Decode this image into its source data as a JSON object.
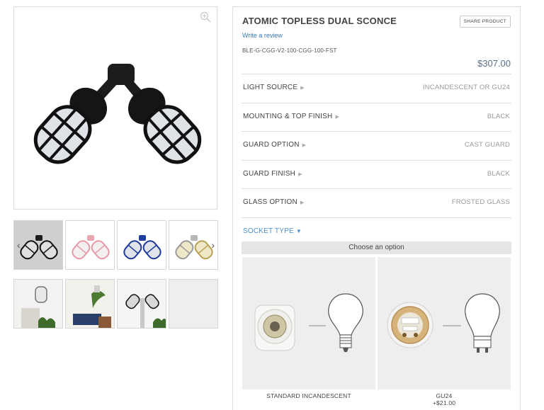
{
  "product": {
    "title": "ATOMIC TOPLESS DUAL SCONCE",
    "share_label": "SHARE PRODUCT",
    "review_link": "Write a review",
    "sku": "BLE-G-CGG-V2-100-CGG-100-FST",
    "price": "$307.00"
  },
  "options": [
    {
      "label": "LIGHT SOURCE",
      "value": "INCANDESCENT OR GU24"
    },
    {
      "label": "MOUNTING & TOP FINISH",
      "value": "BLACK"
    },
    {
      "label": "GUARD OPTION",
      "value": "CAST GUARD"
    },
    {
      "label": "GUARD FINISH",
      "value": "BLACK"
    },
    {
      "label": "GLASS OPTION",
      "value": "FROSTED GLASS"
    }
  ],
  "socket": {
    "label": "SOCKET TYPE",
    "choose_prompt": "Choose an option",
    "choices": [
      {
        "name": "STANDARD INCANDESCENT",
        "price": ""
      },
      {
        "name": "GU24",
        "price": "+$21.00"
      }
    ]
  },
  "gallery": {
    "thumb_colors": [
      "black",
      "pink",
      "blue",
      "silver-brass"
    ],
    "icons": [
      "zoom-icon",
      "chevron-left-icon",
      "chevron-right-icon"
    ]
  },
  "colors": {
    "link": "#3a78b5",
    "socket_label": "#4a90d0",
    "price": "#5b7187"
  }
}
